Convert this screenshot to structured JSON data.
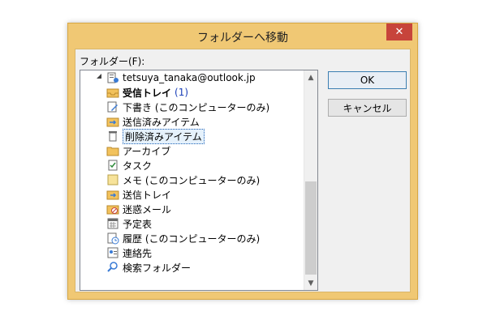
{
  "window": {
    "title": "フォルダーへ移動",
    "close_glyph": "✕"
  },
  "folder_label": "フォルダー(F):",
  "account": "tetsuya_tanaka@outlook.jp",
  "folders": [
    {
      "label": "受信トレイ",
      "count": "(1)",
      "icon": "inbox-icon"
    },
    {
      "label": "下書き (このコンピューターのみ)",
      "icon": "drafts-icon"
    },
    {
      "label": "送信済みアイテム",
      "icon": "sent-icon"
    },
    {
      "label": "削除済みアイテム",
      "icon": "trash-icon",
      "selected": true
    },
    {
      "label": "アーカイブ",
      "icon": "archive-icon"
    },
    {
      "label": "タスク",
      "icon": "tasks-icon"
    },
    {
      "label": "メモ (このコンピューターのみ)",
      "icon": "notes-icon"
    },
    {
      "label": "送信トレイ",
      "icon": "outbox-icon"
    },
    {
      "label": "迷惑メール",
      "icon": "junk-icon"
    },
    {
      "label": "予定表",
      "icon": "calendar-icon"
    },
    {
      "label": "履歴 (このコンピューターのみ)",
      "icon": "history-icon"
    },
    {
      "label": "連絡先",
      "icon": "contacts-icon"
    },
    {
      "label": "検索フォルダー",
      "icon": "search-folder-icon"
    }
  ],
  "buttons": {
    "ok": "OK",
    "cancel": "キャンセル"
  },
  "colors": {
    "accent": "#f0c874",
    "close": "#c7443b",
    "selection": "#e5f1fb"
  }
}
